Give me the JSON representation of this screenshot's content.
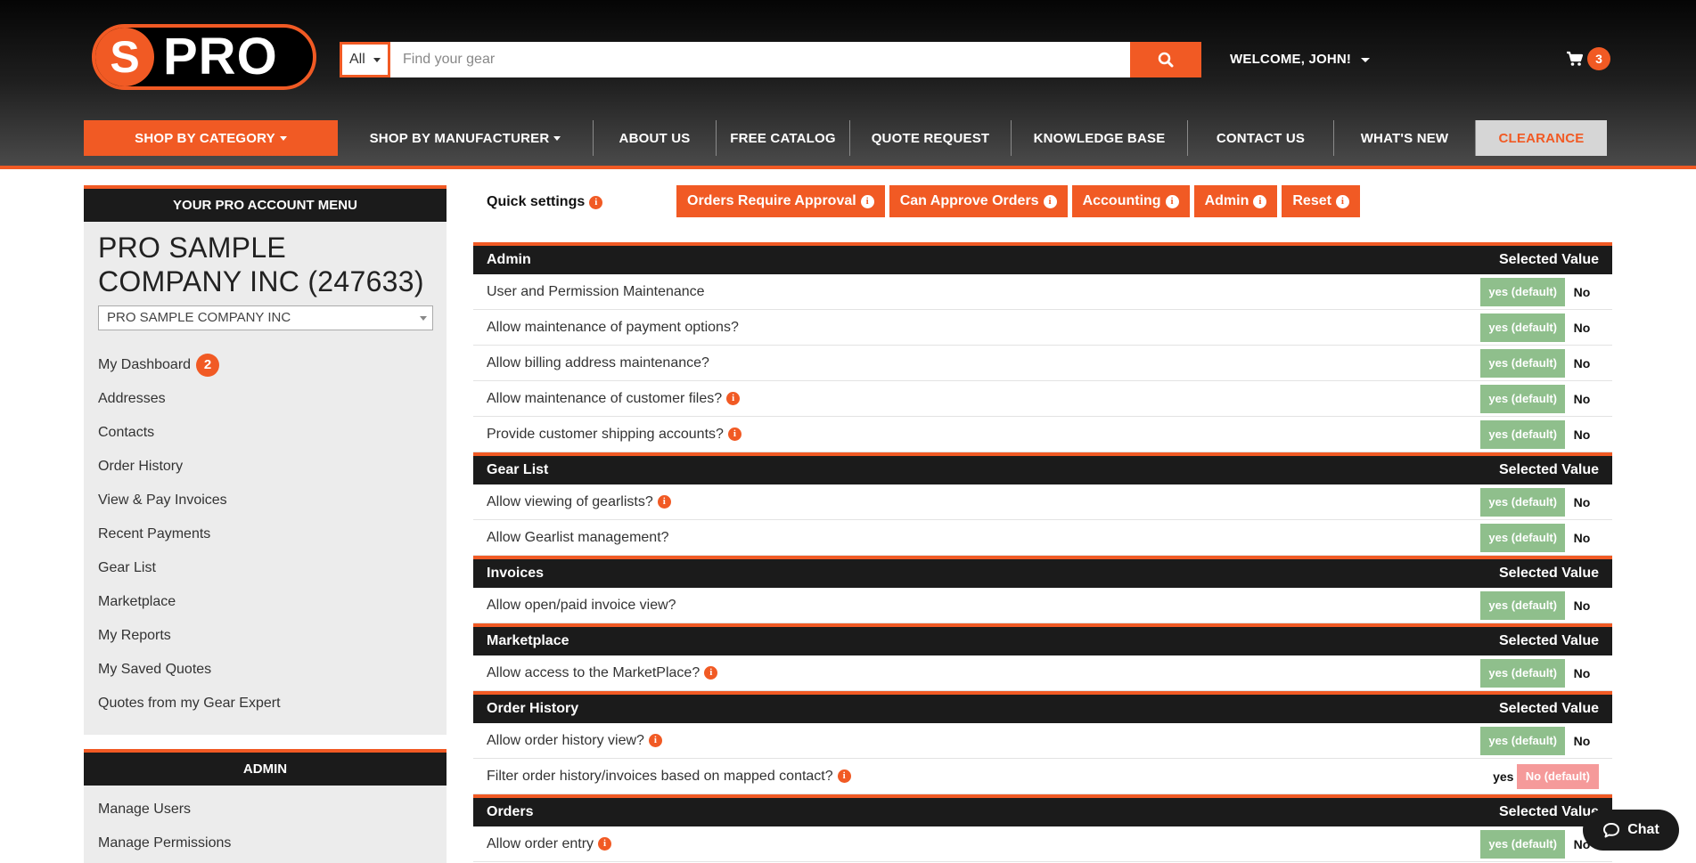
{
  "header": {
    "logo_letter": "S",
    "logo_text": "PRO",
    "search_category": "All",
    "search_placeholder": "Find your gear",
    "welcome": "WELCOME, JOHN!",
    "cart_count": "3"
  },
  "nav": [
    {
      "label": "SHOP BY CATEGORY",
      "dropdown": true
    },
    {
      "label": "SHOP BY MANUFACTURER",
      "dropdown": true
    },
    {
      "label": "ABOUT US"
    },
    {
      "label": "FREE CATALOG"
    },
    {
      "label": "QUOTE REQUEST"
    },
    {
      "label": "KNOWLEDGE BASE"
    },
    {
      "label": "CONTACT US"
    },
    {
      "label": "WHAT'S NEW"
    },
    {
      "label": "CLEARANCE"
    }
  ],
  "sidebar": {
    "title": "YOUR PRO ACCOUNT MENU",
    "company_name": "PRO SAMPLE COMPANY INC (247633)",
    "company_select": "PRO SAMPLE COMPANY INC",
    "items": [
      {
        "label": "My Dashboard",
        "badge": "2"
      },
      {
        "label": "Addresses"
      },
      {
        "label": "Contacts"
      },
      {
        "label": "Order History"
      },
      {
        "label": "View & Pay Invoices"
      },
      {
        "label": "Recent Payments"
      },
      {
        "label": "Gear List"
      },
      {
        "label": "Marketplace"
      },
      {
        "label": "My Reports"
      },
      {
        "label": "My Saved Quotes"
      },
      {
        "label": "Quotes from my Gear Expert"
      }
    ],
    "admin_title": "ADMIN",
    "admin_items": [
      {
        "label": "Manage Users"
      },
      {
        "label": "Manage Permissions"
      }
    ]
  },
  "quick_settings": {
    "label": "Quick settings",
    "buttons": [
      "Orders Require Approval",
      "Can Approve Orders",
      "Accounting",
      "Admin",
      "Reset"
    ]
  },
  "selected_value_label": "Selected Value",
  "sections": [
    {
      "title": "Admin",
      "rows": [
        {
          "label": "User and Permission Maintenance",
          "info": false,
          "yes": "yes (default)",
          "no": "No",
          "default": "yes"
        },
        {
          "label": "Allow maintenance of payment options?",
          "info": false,
          "yes": "yes (default)",
          "no": "No",
          "default": "yes"
        },
        {
          "label": "Allow billing address maintenance?",
          "info": false,
          "yes": "yes (default)",
          "no": "No",
          "default": "yes"
        },
        {
          "label": "Allow maintenance of customer files?",
          "info": true,
          "yes": "yes (default)",
          "no": "No",
          "default": "yes"
        },
        {
          "label": "Provide customer shipping accounts?",
          "info": true,
          "yes": "yes (default)",
          "no": "No",
          "default": "yes"
        }
      ]
    },
    {
      "title": "Gear List",
      "rows": [
        {
          "label": "Allow viewing of gearlists?",
          "info": true,
          "yes": "yes (default)",
          "no": "No",
          "default": "yes"
        },
        {
          "label": "Allow Gearlist management?",
          "info": false,
          "yes": "yes (default)",
          "no": "No",
          "default": "yes"
        }
      ]
    },
    {
      "title": "Invoices",
      "rows": [
        {
          "label": "Allow open/paid invoice view?",
          "info": false,
          "yes": "yes (default)",
          "no": "No",
          "default": "yes"
        }
      ]
    },
    {
      "title": "Marketplace",
      "rows": [
        {
          "label": "Allow access to the MarketPlace?",
          "info": true,
          "yes": "yes (default)",
          "no": "No",
          "default": "yes"
        }
      ]
    },
    {
      "title": "Order History",
      "rows": [
        {
          "label": "Allow order history view?",
          "info": true,
          "yes": "yes (default)",
          "no": "No",
          "default": "yes"
        },
        {
          "label": "Filter order history/invoices based on mapped contact?",
          "info": true,
          "yes": "yes",
          "no": "No (default)",
          "default": "no"
        }
      ]
    },
    {
      "title": "Orders",
      "rows": [
        {
          "label": "Allow order entry",
          "info": true,
          "yes": "yes (default)",
          "no": "No",
          "default": "yes"
        }
      ]
    }
  ],
  "chat_label": "Chat",
  "colors": {
    "accent": "#f15a24",
    "dark": "#1b1b1b",
    "yes_default": "#8fbf8c",
    "no_default": "#f59a9a",
    "sidebar_bg": "#ececec"
  }
}
